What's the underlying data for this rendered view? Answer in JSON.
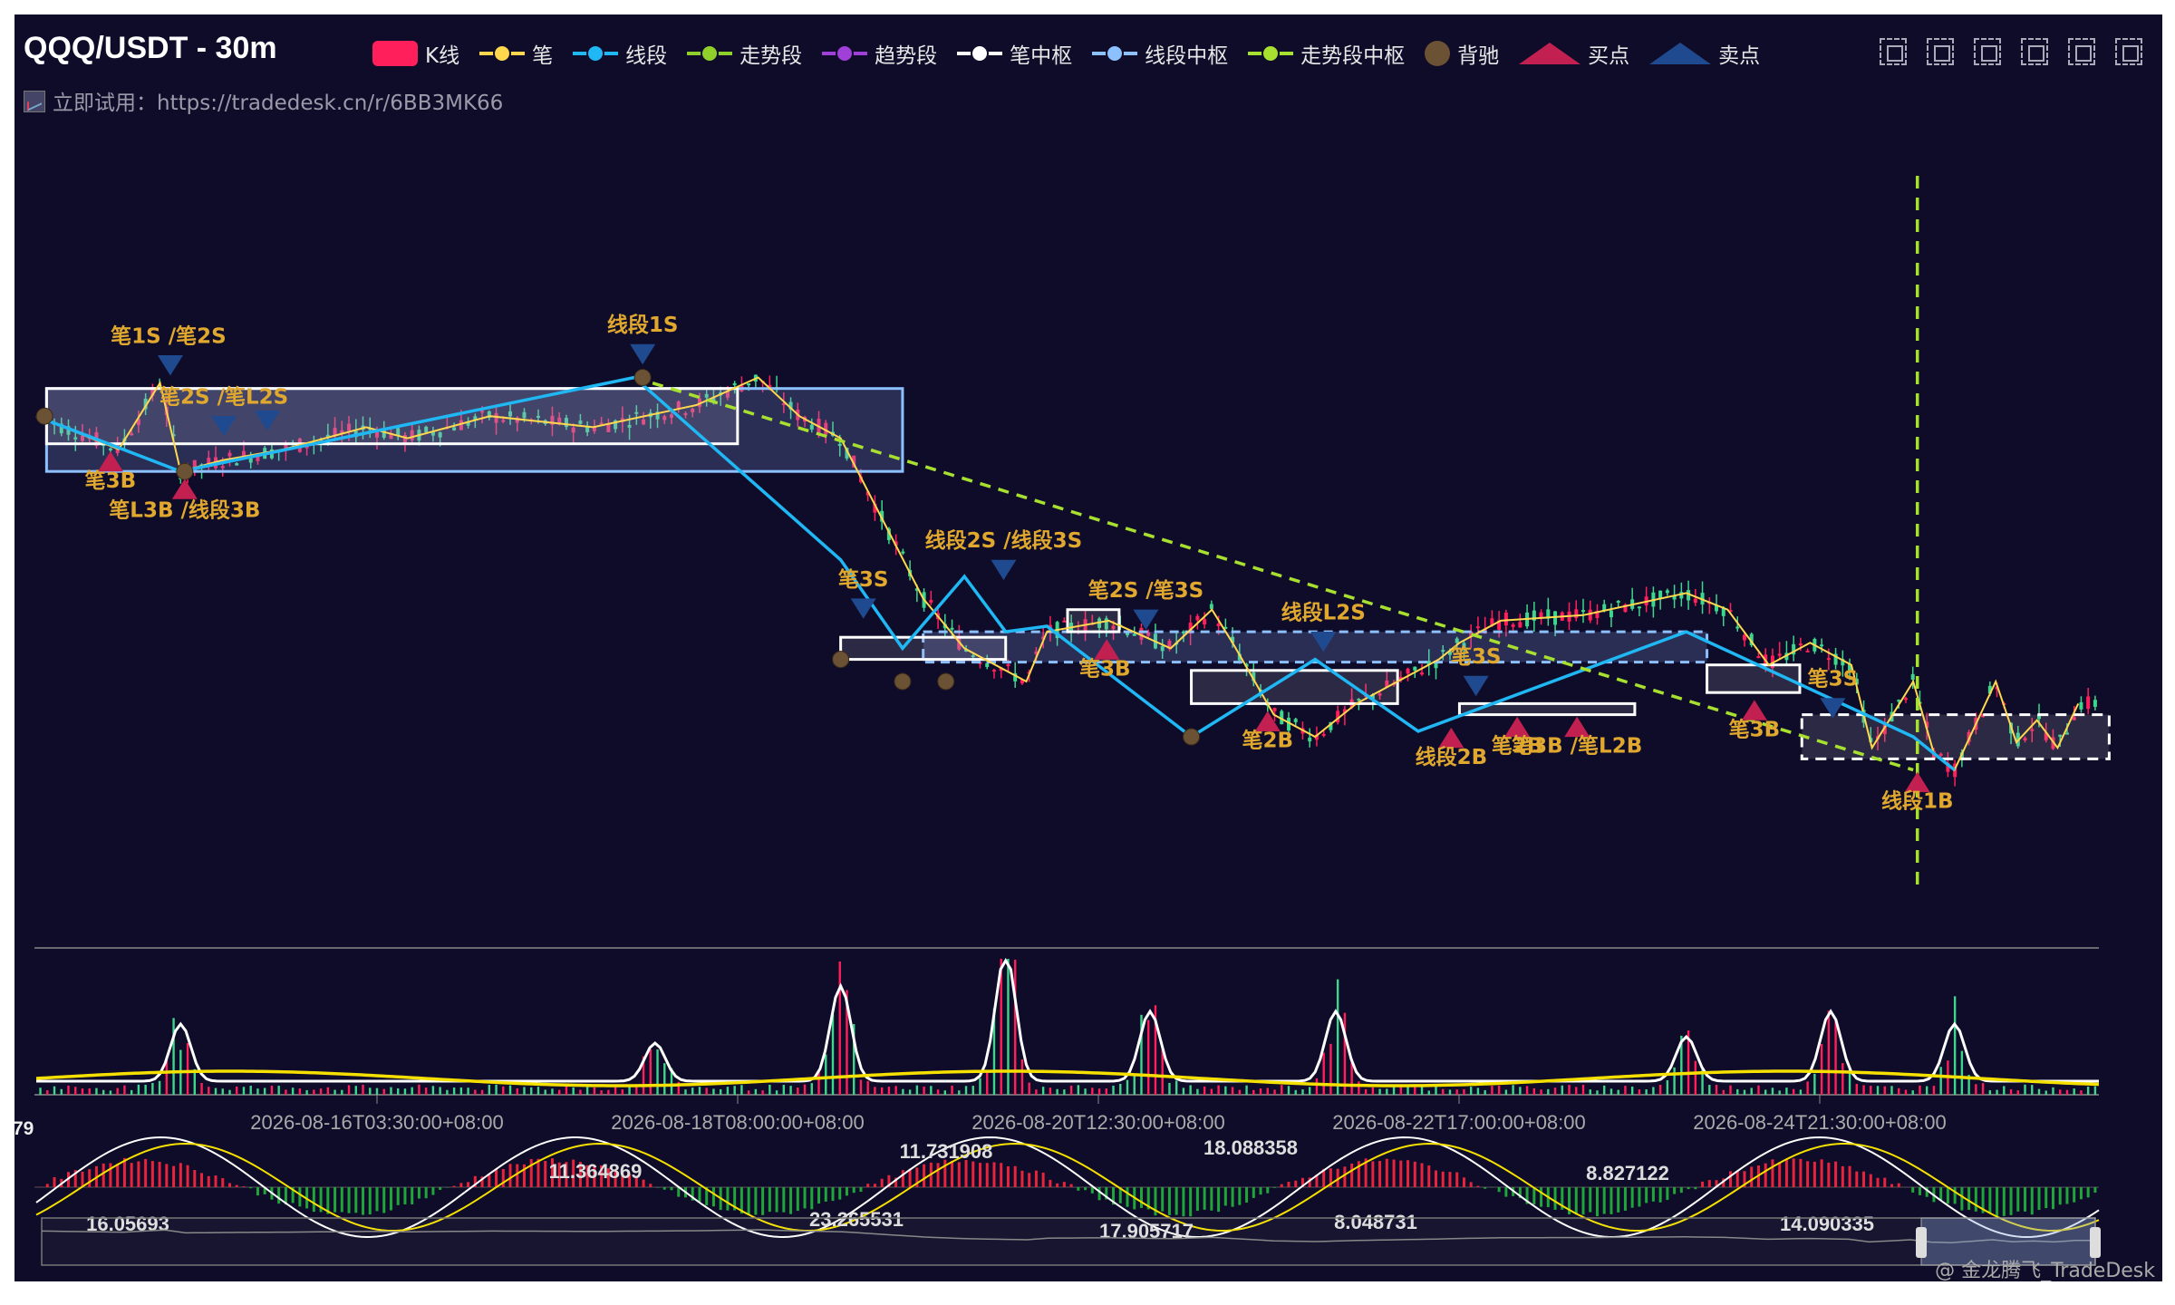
{
  "header": {
    "symbol_title": "QQQ/USDT - 30m",
    "promo_text": "立即试用：https://tradedesk.cn/r/6BB3MK66"
  },
  "legend": [
    {
      "label": "K线",
      "kind": "rect",
      "color": "#ff1f5a"
    },
    {
      "label": "笔",
      "kind": "line",
      "color": "#ffd84d"
    },
    {
      "label": "线段",
      "kind": "line",
      "color": "#1fb8f5"
    },
    {
      "label": "走势段",
      "kind": "line",
      "color": "#8fd12a"
    },
    {
      "label": "趋势段",
      "kind": "line",
      "color": "#a040d8"
    },
    {
      "label": "笔中枢",
      "kind": "line",
      "color": "#ffffff"
    },
    {
      "label": "线段中枢",
      "kind": "line",
      "color": "#8cc0ff"
    },
    {
      "label": "走势段中枢",
      "kind": "line",
      "color": "#a8e030"
    },
    {
      "label": "背驰",
      "kind": "dot",
      "color": "#6b5234"
    },
    {
      "label": "买点",
      "kind": "tri",
      "color": "#c22050"
    },
    {
      "label": "卖点",
      "kind": "tri",
      "color": "#1f4a8f"
    }
  ],
  "toolbar": [
    "zoom-icon",
    "lasso-icon",
    "brush-icon",
    "fullscreen-icon",
    "restore-icon",
    "clear-icon"
  ],
  "watermark": "@ 金龙腾飞_TradeDesk",
  "colors": {
    "background": "#0f0c29",
    "up": "#ff1f5a",
    "down": "#3dd68c",
    "bi": "#ffd84d",
    "duan": "#1fb8f5",
    "trend": "#a8e030",
    "bi_zs": "#ffffff",
    "duan_zs": "#8cc0ff",
    "buy": "#c22050",
    "sell": "#1f4a8f",
    "divergence": "#6b5234",
    "label": "#e0a82e",
    "vol_line": "#ffffff",
    "vol_ma": "#f5e000",
    "macd_pos": "#e8243c",
    "macd_neg": "#1fa53a",
    "dif": "#ffffff",
    "dea": "#f5e000"
  },
  "chart_data": {
    "type": "line",
    "title": "QQQ/USDT - 30m",
    "x_ticks": [
      "2026-08-16T03:30:00+08:00",
      "2026-08-18T08:00:00+08:00",
      "2026-08-20T12:30:00+08:00",
      "2026-08-22T17:00:00+08:00",
      "2026-08-24T21:30:00+08:00"
    ],
    "x_range": [
      0,
      100
    ],
    "price_range": [
      0,
      100
    ],
    "bi": [
      [
        0,
        88
      ],
      [
        4,
        82
      ],
      [
        6,
        94
      ],
      [
        7,
        78
      ],
      [
        9,
        80
      ],
      [
        12,
        82
      ],
      [
        16,
        86
      ],
      [
        18,
        84
      ],
      [
        22,
        88
      ],
      [
        27,
        86
      ],
      [
        32,
        90
      ],
      [
        35,
        95
      ],
      [
        37,
        88
      ],
      [
        39,
        84
      ],
      [
        43,
        55
      ],
      [
        45,
        46
      ],
      [
        48,
        40
      ],
      [
        49,
        49
      ],
      [
        52,
        51
      ],
      [
        55,
        46
      ],
      [
        57,
        53
      ],
      [
        58,
        47
      ],
      [
        60,
        34
      ],
      [
        62,
        30
      ],
      [
        64,
        36
      ],
      [
        66,
        40
      ],
      [
        68,
        44
      ],
      [
        69,
        47
      ],
      [
        71,
        51
      ],
      [
        75,
        52
      ],
      [
        80,
        56
      ],
      [
        82,
        53
      ],
      [
        84,
        43
      ],
      [
        86,
        47
      ],
      [
        88,
        43
      ],
      [
        89,
        28
      ],
      [
        91,
        40
      ],
      [
        92,
        27
      ],
      [
        93,
        24
      ],
      [
        95,
        40
      ],
      [
        96,
        29
      ],
      [
        97,
        33
      ],
      [
        98,
        28
      ],
      [
        99,
        36
      ]
    ],
    "duan": [
      [
        0,
        88
      ],
      [
        7,
        78
      ],
      [
        29,
        95
      ],
      [
        39,
        62
      ],
      [
        42,
        46
      ],
      [
        45,
        59
      ],
      [
        47,
        49
      ],
      [
        49,
        50
      ],
      [
        56,
        30
      ],
      [
        62,
        44
      ],
      [
        67,
        31
      ],
      [
        80,
        49
      ],
      [
        91,
        30
      ],
      [
        93,
        24
      ]
    ],
    "trend_line": [
      [
        29,
        95
      ],
      [
        91,
        24
      ]
    ],
    "trend_vline_x": 91.2,
    "bi_zs": [
      {
        "x0": 0.5,
        "x1": 34,
        "lo": 83,
        "hi": 93
      },
      {
        "x0": 39,
        "x1": 47,
        "lo": 44,
        "hi": 48
      },
      {
        "x0": 50,
        "x1": 52.5,
        "lo": 49,
        "hi": 53
      },
      {
        "x0": 56,
        "x1": 66,
        "lo": 36,
        "hi": 42
      },
      {
        "x0": 69,
        "x1": 77.5,
        "lo": 34,
        "hi": 36
      },
      {
        "x0": 81,
        "x1": 85.5,
        "lo": 38,
        "hi": 43
      },
      {
        "x0": 85.6,
        "x1": 100.5,
        "lo": 26,
        "hi": 34,
        "dashed": true
      }
    ],
    "duan_zs": [
      {
        "x0": 0.5,
        "x1": 42,
        "lo": 78,
        "hi": 93
      },
      {
        "x0": 43,
        "x1": 81,
        "lo": 43.5,
        "hi": 49,
        "dashed": true
      }
    ],
    "buy_points": [
      {
        "x": 3.6,
        "y": 81,
        "label": "笔3B",
        "dx": 0,
        "dy": 26
      },
      {
        "x": 7.2,
        "y": 76,
        "label": "笔L3B /线段3B",
        "dx": 0,
        "dy": 28
      },
      {
        "x": 51.9,
        "y": 47,
        "label": "笔3B",
        "dx": -2,
        "dy": 26
      },
      {
        "x": 59.7,
        "y": 34,
        "label": "笔2B",
        "dx": 0,
        "dy": 26
      },
      {
        "x": 68.6,
        "y": 31,
        "label": "线段2B",
        "dx": 0,
        "dy": 26
      },
      {
        "x": 71.8,
        "y": 33,
        "label": "笔2B",
        "dx": 0,
        "dy": 26
      },
      {
        "x": 74.7,
        "y": 33,
        "label": "笔3B /笔L2B",
        "dx": 0,
        "dy": 26
      },
      {
        "x": 83.3,
        "y": 36,
        "label": "笔3B",
        "dx": 0,
        "dy": 26
      },
      {
        "x": 91.2,
        "y": 23,
        "label": "线段1B",
        "dx": 0,
        "dy": 26
      }
    ],
    "sell_points": [
      {
        "x": 6.5,
        "y": 96,
        "label": "笔1S /笔2S",
        "dx": -2,
        "dy": -22
      },
      {
        "x": 9.1,
        "y": 85,
        "label": "笔2S /笔L2S",
        "dx": 0,
        "dy": -22
      },
      {
        "x": 11.2,
        "y": 86,
        "label": "",
        "dx": 0,
        "dy": -22
      },
      {
        "x": 29.4,
        "y": 98,
        "label": "线段1S",
        "dx": 0,
        "dy": -22
      },
      {
        "x": 40.1,
        "y": 52,
        "label": "笔3S",
        "dx": 0,
        "dy": -22
      },
      {
        "x": 46.9,
        "y": 59,
        "label": "线段2S /线段3S",
        "dx": 0,
        "dy": -22
      },
      {
        "x": 53.8,
        "y": 50,
        "label": "笔2S /笔3S",
        "dx": 0,
        "dy": -22
      },
      {
        "x": 62.4,
        "y": 46,
        "label": "线段L2S",
        "dx": 0,
        "dy": -22
      },
      {
        "x": 69.8,
        "y": 38,
        "label": "笔3S",
        "dx": 0,
        "dy": -22
      },
      {
        "x": 87.1,
        "y": 34,
        "label": "笔3S",
        "dx": 0,
        "dy": -22
      }
    ],
    "divergence_points": [
      [
        0.4,
        88
      ],
      [
        7.2,
        78
      ],
      [
        29.4,
        95
      ],
      [
        39.0,
        44
      ],
      [
        42.0,
        40
      ],
      [
        44.1,
        40
      ],
      [
        56.0,
        30
      ]
    ],
    "volume_peaks": [
      [
        7,
        0.45
      ],
      [
        30,
        0.3
      ],
      [
        39,
        0.75
      ],
      [
        47,
        1.0
      ],
      [
        54,
        0.55
      ],
      [
        63,
        0.55
      ],
      [
        80,
        0.35
      ],
      [
        87,
        0.55
      ],
      [
        93,
        0.45
      ]
    ],
    "macd_labels": [
      "16.05693",
      "11.364869",
      "23.265531",
      "11.731908",
      "17.905717",
      "18.088358",
      "8.048731",
      "8.827122",
      "14.090335"
    ],
    "macd_left_value": "79"
  }
}
